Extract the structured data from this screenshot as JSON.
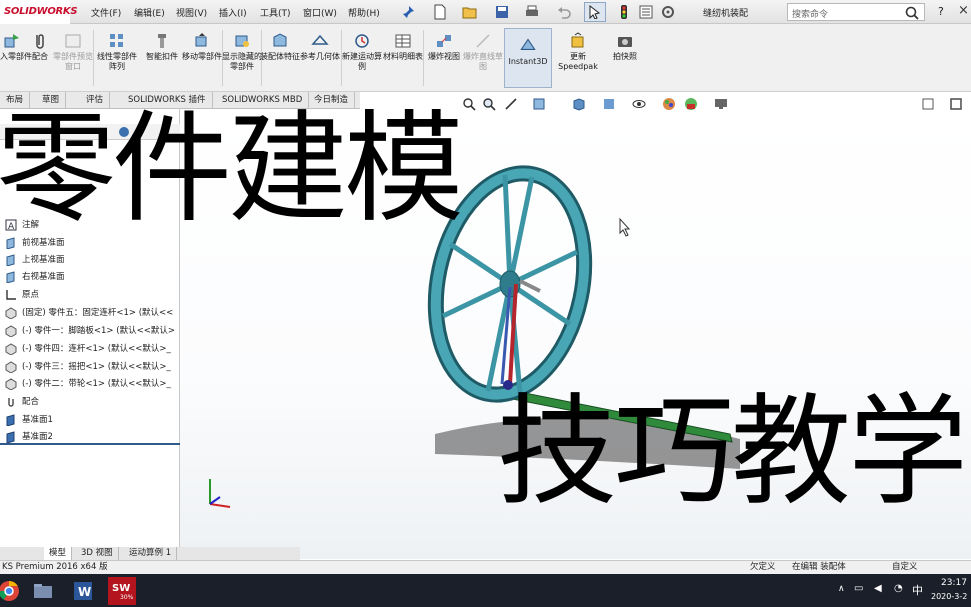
{
  "app": {
    "logo": "SOLIDWORKS",
    "doc_title": "缝纫机装配",
    "search_placeholder": "搜索命令",
    "help": "?",
    "close": "×"
  },
  "menu": [
    "文件(F)",
    "编辑(E)",
    "视图(V)",
    "插入(I)",
    "工具(T)",
    "窗口(W)",
    "帮助(H)"
  ],
  "commands": [
    {
      "label": "插入零部件",
      "disabled": false
    },
    {
      "label": "配合",
      "disabled": false
    },
    {
      "label": "零部件预览窗口",
      "disabled": true
    },
    {
      "label": "线性零部件阵列",
      "disabled": false
    },
    {
      "label": "智能扣件",
      "disabled": false
    },
    {
      "label": "移动零部件",
      "disabled": false
    },
    {
      "label": "显示隐藏的零部件",
      "disabled": false
    },
    {
      "label": "装配体特征",
      "disabled": false
    },
    {
      "label": "参考几何体",
      "disabled": false
    },
    {
      "label": "新建运动算例",
      "disabled": false
    },
    {
      "label": "材料明细表",
      "disabled": false
    },
    {
      "label": "爆炸视图",
      "disabled": false
    },
    {
      "label": "爆炸直线草图",
      "disabled": true
    },
    {
      "label": "Instant3D",
      "disabled": false
    },
    {
      "label": "更新Speedpak",
      "disabled": false
    },
    {
      "label": "拍快照",
      "disabled": false
    }
  ],
  "tabs": [
    "布局",
    "草图",
    "评估",
    "SOLIDWORKS 插件",
    "SOLIDWORKS MBD",
    "今日制造"
  ],
  "tree": [
    {
      "label": "注解",
      "icon": "annotation-icon"
    },
    {
      "label": "前视基准面",
      "icon": "plane-icon"
    },
    {
      "label": "上视基准面",
      "icon": "plane-icon"
    },
    {
      "label": "右视基准面",
      "icon": "plane-icon"
    },
    {
      "label": "原点",
      "icon": "origin-icon"
    },
    {
      "label": "(固定) 零件五：固定连杆<1> (默认<<",
      "icon": "part-icon"
    },
    {
      "label": "(-) 零件一：脚踏板<1> (默认<<默认>",
      "icon": "part-icon"
    },
    {
      "label": "(-) 零件四：连杆<1> (默认<<默认>_",
      "icon": "part-icon"
    },
    {
      "label": "(-) 零件三：摇把<1> (默认<<默认>_",
      "icon": "part-icon"
    },
    {
      "label": "(-) 零件二：带轮<1> (默认<<默认>_",
      "icon": "part-icon"
    },
    {
      "label": "配合",
      "icon": "mate-icon"
    },
    {
      "label": "基准面1",
      "icon": "plane-icon"
    },
    {
      "label": "基准面2",
      "icon": "plane-icon"
    }
  ],
  "bottom_tabs": [
    "模型",
    "3D 视图",
    "运动算例 1"
  ],
  "status": {
    "product": "KS Premium 2016 x64 版",
    "s1": "欠定义",
    "s2": "在编辑 装配体",
    "s3": "自定义"
  },
  "taskbar": {
    "time": "23:17",
    "date": "2020-3-2",
    "ime": "中",
    "ws_badge": "30%"
  },
  "overlay": {
    "title": "零件建模",
    "subtitle": "技巧教学"
  },
  "colors": {
    "accent": "#c8102e",
    "wheel": "#2f7d8c",
    "rod": "#b5252d",
    "base": "#1f6b2b"
  }
}
